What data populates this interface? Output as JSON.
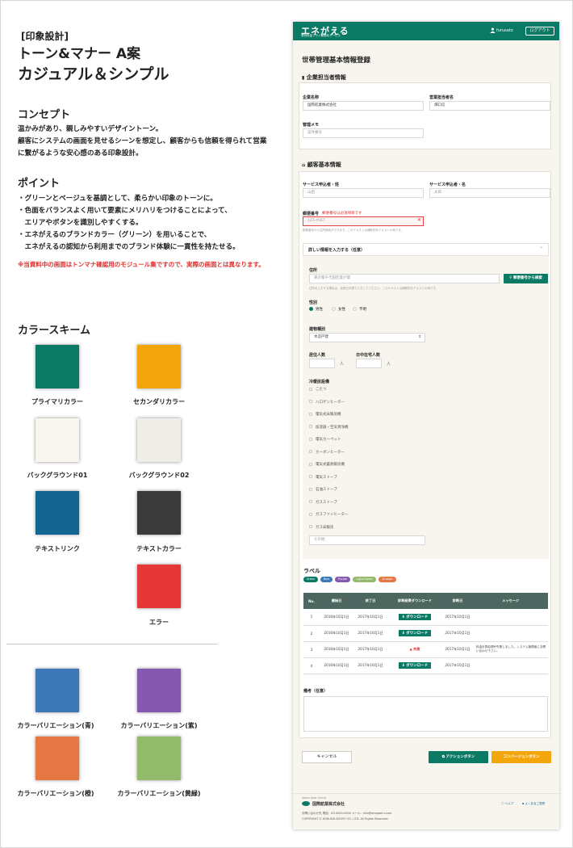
{
  "left": {
    "tag": "[印象設計]",
    "title1": "トーン&マナー A案",
    "title2": "カジュアル＆シンプル",
    "concept_heading": "コンセプト",
    "concept_lines": [
      "温かみがあり、親しみやすいデザイントーン。",
      "顧客にシステムの画面を見せるシーンを想定し、顧客からも信頼を得られて営業",
      "に繋がるような安心感のある印象設計。"
    ],
    "point_heading": "ポイント",
    "point_lines": [
      "・グリーンとベージュを基調として、柔らかい印象のトーンに。",
      "・色面をバランスよく用いて要素にメリハリをつけることによって、",
      "　エリアやボタンを識別しやすくする。",
      "・エネがえるのブランドカラー（グリーン）を用いることで、",
      "　エネがえるの認知から利用までのブランド体験に一貫性を持たせる。"
    ],
    "note": "※当資料中の画面はトンマナ確認用のモジュール集ですので、実際の画面とは異なります。",
    "scheme_heading": "カラースキーム",
    "swatches": [
      {
        "label": "プライマリカラー",
        "color": "#0a7a64"
      },
      {
        "label": "セカンダリカラー",
        "color": "#f3a50c"
      },
      {
        "label": "バックグラウンド01",
        "color": "#f8f6ef"
      },
      {
        "label": "バックグラウンド02",
        "color": "#efede7"
      },
      {
        "label": "テキストリンク",
        "color": "#156592"
      },
      {
        "label": "テキストカラー",
        "color": "#3a3a3a"
      },
      {
        "label": "エラー",
        "color": "#e63739"
      }
    ],
    "variations": [
      {
        "label": "カラーバリエーション(青)",
        "color": "#3c78b7"
      },
      {
        "label": "カラーバリエーション(紫)",
        "color": "#8659b0"
      },
      {
        "label": "カラーバリエーション(橙)",
        "color": "#e47744"
      },
      {
        "label": "カラーバリエーション(黄緑)",
        "color": "#93b96a"
      }
    ]
  },
  "app": {
    "logo": "エネがえる",
    "logo_sub": "電気料金プラン最適化サービス",
    "user": "furusato",
    "logout": "ログアウト",
    "page_title": "世帯管理基本情報登録",
    "company_section": "企業担当者情報",
    "company_name_label": "企業名称",
    "company_name_value": "国際航業株式会社",
    "sales_name_label": "営業担当者名",
    "sales_name_value": "畑口信",
    "memo_label": "管理メモ",
    "memo_placeholder": "案件番号",
    "customer_section": "顧客基本情報",
    "last_name_label": "サービス申込者・姓",
    "last_name_placeholder": "山田",
    "first_name_label": "サービス申込者・名",
    "first_name_placeholder": "太郎",
    "zip_label": "郵便番号",
    "zip_error": "郵便番号は必須項目です",
    "zip_placeholder": "123-4567",
    "zip_help": "郵便番号から住所検索ができます。このテキストは補助的なテキストの例です。",
    "detail_toggle": "詳しい情報を入力する（任意）",
    "address_label": "住所",
    "address_placeholder": "東京都千代田区霞が関",
    "address_search": "郵便番号から検索",
    "address_help": "住所を入力する場合は、全角日本語で入力してください。このテキストは補助的なテキストの例です。",
    "gender_label": "性別",
    "gender_options": [
      "男性",
      "女性",
      "不明"
    ],
    "building_label": "建物種別",
    "building_value": "木造戸建",
    "residents_label": "居住人数",
    "day_residents_label": "日中在宅人数",
    "unit": "人",
    "equipment_label": "冷暖房設備",
    "equipment": [
      "こたつ",
      "ハロゲンヒーター",
      "電気式床暖房機",
      "加湿器・空気清浄機",
      "電気カーペット",
      "カーボンヒーター",
      "電気式蓄熱暖房機",
      "電気ストーブ",
      "石油ストーブ",
      "ガスストーブ",
      "ガスファンヒーター",
      "ガス床暖房"
    ],
    "equipment_other_placeholder": "その他",
    "labels_heading": "ラベル",
    "badges": [
      {
        "text": "Green",
        "color": "#0a7a64"
      },
      {
        "text": "Blue",
        "color": "#3c78b7"
      },
      {
        "text": "Purple",
        "color": "#8659b0"
      },
      {
        "text": "Light Green",
        "color": "#93b96a"
      },
      {
        "text": "Orange",
        "color": "#e47744"
      }
    ],
    "table_headers": [
      "No.",
      "開始日",
      "終了日",
      "診断結果ダウンロード",
      "診断日",
      "メッセージ"
    ],
    "table_rows": [
      {
        "no": "1",
        "start": "2016年10月1日",
        "end": "2017年10月1日",
        "result": "ダウンロード",
        "date": "2017年10月1日",
        "msg": ""
      },
      {
        "no": "2",
        "start": "2016年10月1日",
        "end": "2017年10月1日",
        "result": "ダウンロード",
        "date": "2017年10月1日",
        "msg": ""
      },
      {
        "no": "3",
        "start": "2016年10月1日",
        "end": "2017年10月1日",
        "result": "失敗",
        "date": "2017年10月1日",
        "msg": "料金計算処理が失敗しました。システム管理者にお問い合わせ下さい。"
      },
      {
        "no": "4",
        "start": "2016年10月1日",
        "end": "2017年10月1日",
        "result": "ダウンロード",
        "date": "2017年10月1日",
        "msg": ""
      }
    ],
    "remarks_label": "備考（任意）",
    "cancel": "キャンセル",
    "action": "アクションボタン",
    "conversion": "コンバージョンボタン",
    "footer_group": "Japan Asia Group",
    "footer_company": "国際航業株式会社",
    "footer_help": "ヘルプ",
    "footer_faq": "よくあるご質問",
    "footer_contact": "お問い合わせ先 電話：03-0000-0000 メール：info@enegaeru.com",
    "footer_copy": "COPYRIGHT © KOKUSAI KOGYO CO., LTD. All Rights Reserved."
  }
}
